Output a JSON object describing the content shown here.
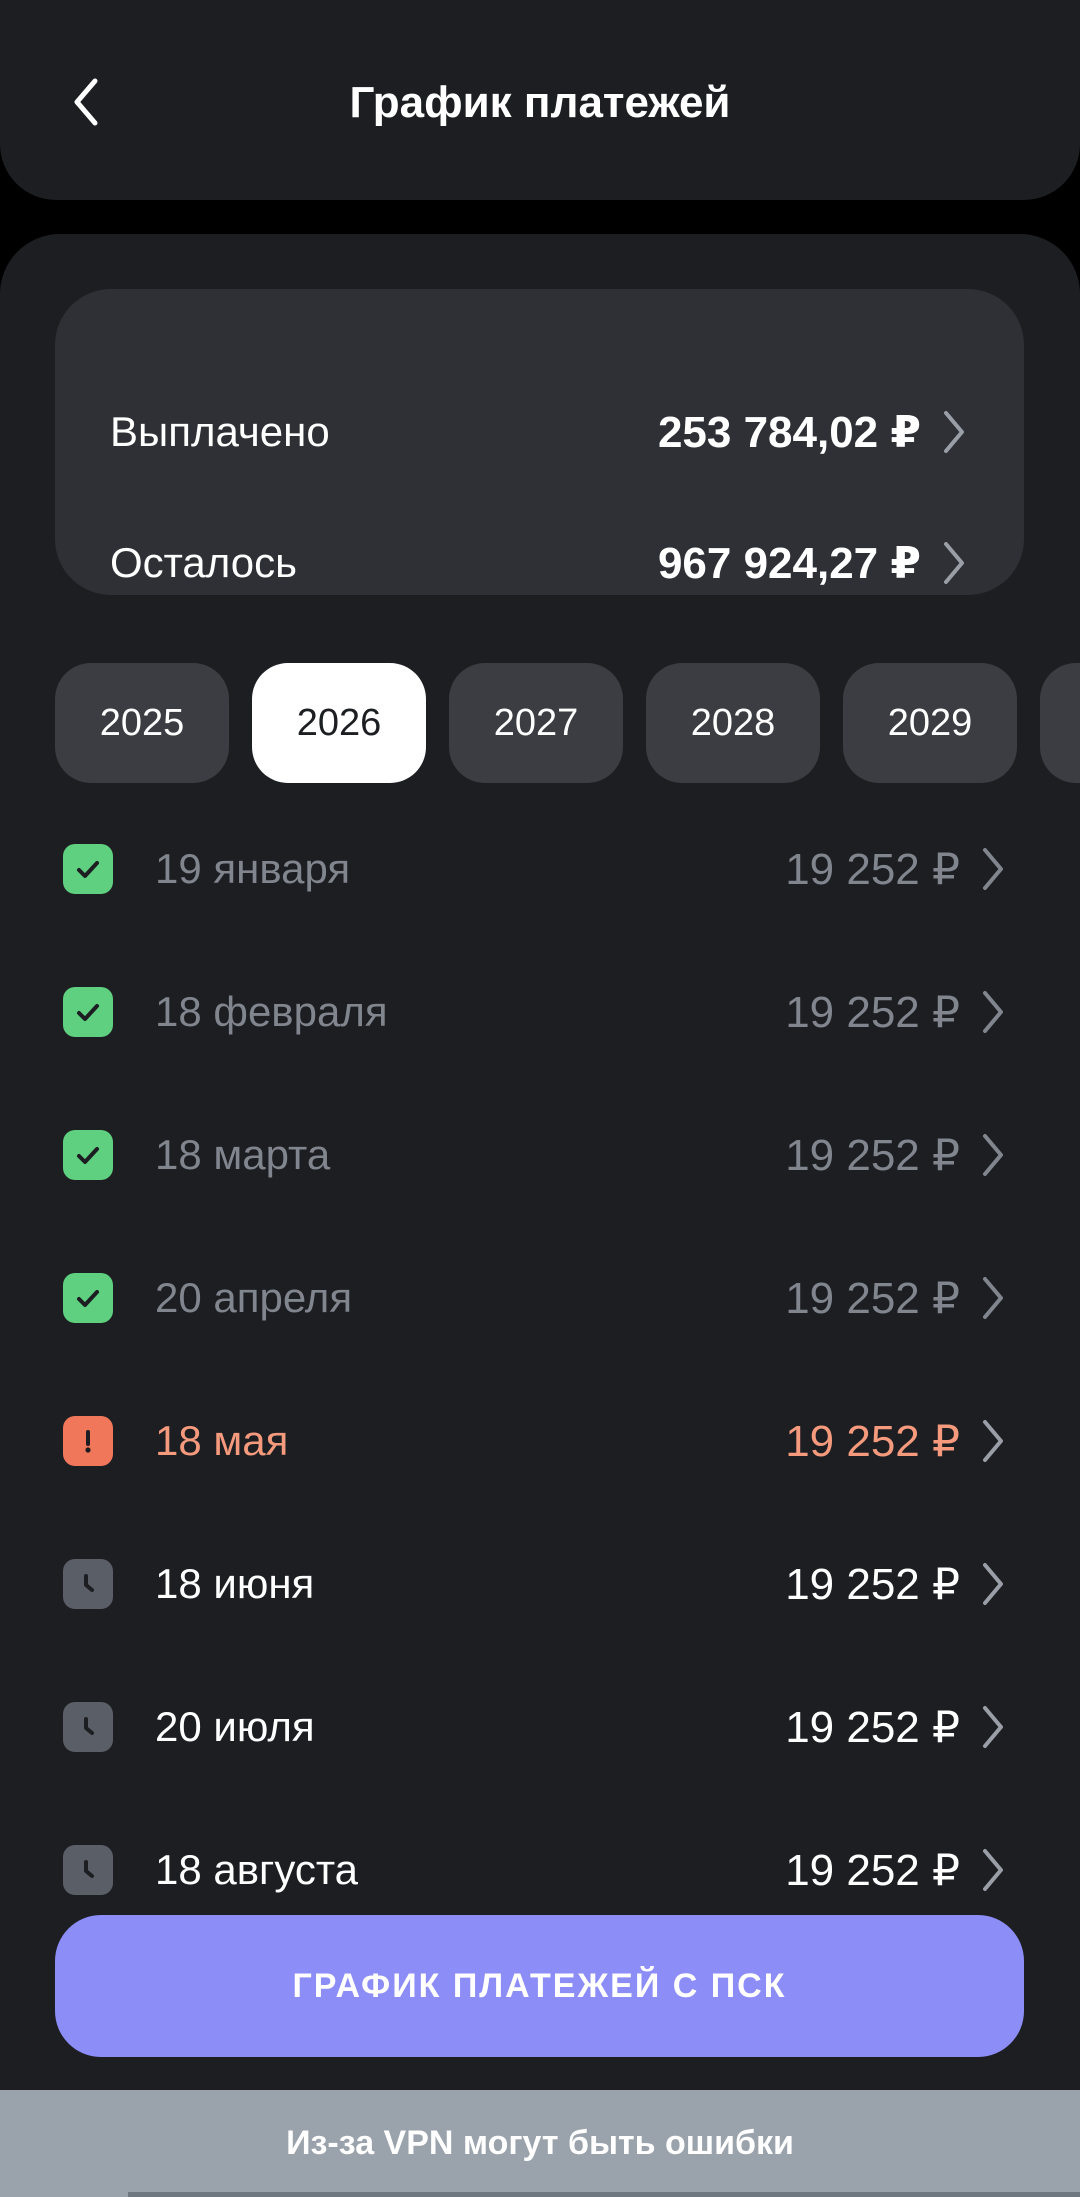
{
  "header": {
    "title": "График платежей",
    "back_icon": "chevron-left-icon"
  },
  "summary": {
    "paid_label": "Выплачено",
    "paid_value": "253 784,02 ₽",
    "remaining_label": "Осталось",
    "remaining_value": "967 924,27 ₽"
  },
  "years": {
    "selected": "2026",
    "items": [
      "2025",
      "2026",
      "2027",
      "2028",
      "2029"
    ]
  },
  "payments": [
    {
      "date": "19 января",
      "amount": "19 252 ₽",
      "status": "paid"
    },
    {
      "date": "18 февраля",
      "amount": "19 252 ₽",
      "status": "paid"
    },
    {
      "date": "18 марта",
      "amount": "19 252 ₽",
      "status": "paid"
    },
    {
      "date": "20 апреля",
      "amount": "19 252 ₽",
      "status": "paid"
    },
    {
      "date": "18 мая",
      "amount": "19 252 ₽",
      "status": "overdue"
    },
    {
      "date": "18 июня",
      "amount": "19 252 ₽",
      "status": "pending"
    },
    {
      "date": "20 июля",
      "amount": "19 252 ₽",
      "status": "pending"
    },
    {
      "date": "18 августа",
      "amount": "19 252 ₽",
      "status": "pending"
    }
  ],
  "psk_button": {
    "label": "ГРАФИК ПЛАТЕЖЕЙ С ПСК"
  },
  "vpn_notice": {
    "text": "Из-за VPN могут быть ошибки"
  },
  "colors": {
    "background": "#1c1e22",
    "card": "#2e3035",
    "paid": "#5fcf80",
    "overdue": "#f0775a",
    "pending": "#5a5e67",
    "accent_button": "#8d8df8"
  }
}
